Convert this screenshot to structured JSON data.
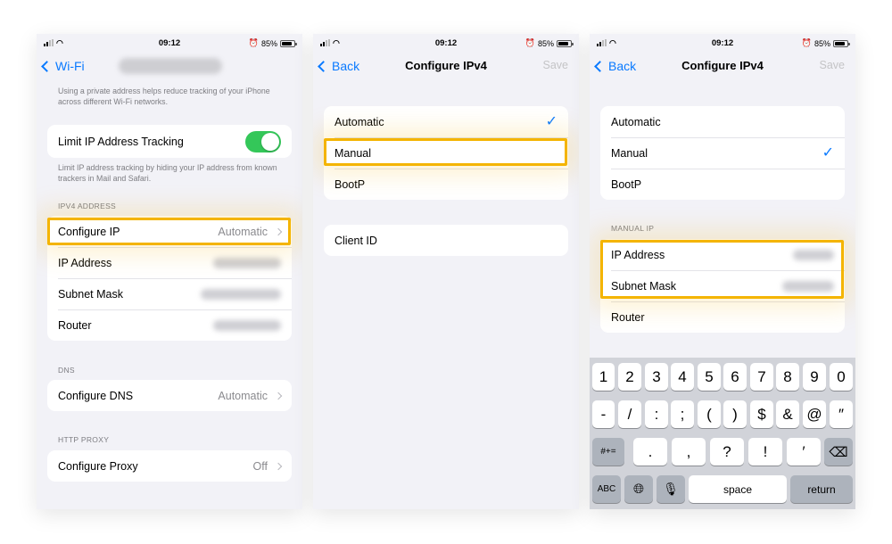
{
  "status": {
    "time": "09:12",
    "battery": "85%",
    "alarm_icon": "alarm-icon"
  },
  "screen1": {
    "back_label": "Wi-Fi",
    "private_note": "Using a private address helps reduce tracking of your iPhone across different Wi-Fi networks.",
    "limit_tracking_label": "Limit IP Address Tracking",
    "limit_tracking_on": true,
    "limit_note": "Limit IP address tracking by hiding your IP address from known trackers in Mail and Safari.",
    "ipv4_header": "IPV4 ADDRESS",
    "configure_ip_label": "Configure IP",
    "configure_ip_value": "Automatic",
    "ip_address_label": "IP Address",
    "subnet_mask_label": "Subnet Mask",
    "router_label": "Router",
    "dns_header": "DNS",
    "configure_dns_label": "Configure DNS",
    "configure_dns_value": "Automatic",
    "proxy_header": "HTTP PROXY",
    "configure_proxy_label": "Configure Proxy",
    "configure_proxy_value": "Off"
  },
  "screen2": {
    "back_label": "Back",
    "title": "Configure IPv4",
    "save_label": "Save",
    "options": [
      "Automatic",
      "Manual",
      "BootP"
    ],
    "selected": "Automatic",
    "client_id_label": "Client ID"
  },
  "screen3": {
    "back_label": "Back",
    "title": "Configure IPv4",
    "save_label": "Save",
    "options": [
      "Automatic",
      "Manual",
      "BootP"
    ],
    "selected": "Manual",
    "manual_header": "MANUAL IP",
    "ip_address_label": "IP Address",
    "subnet_mask_label": "Subnet Mask",
    "router_label": "Router",
    "keyboard": {
      "row1": [
        "1",
        "2",
        "3",
        "4",
        "5",
        "6",
        "7",
        "8",
        "9",
        "0"
      ],
      "row2": [
        "-",
        "/",
        ":",
        ";",
        "(",
        ")",
        "$",
        "&",
        "@",
        "″"
      ],
      "row3": [
        "#+=",
        ".",
        ",",
        "?",
        "!",
        "′",
        "⌫"
      ],
      "row4": [
        "ABC",
        "globe-icon",
        "microphone-icon",
        "space",
        "return"
      ]
    }
  },
  "colors": {
    "accent": "#0a7aff",
    "highlight": "#f4b400",
    "toggle_on": "#34c759"
  }
}
